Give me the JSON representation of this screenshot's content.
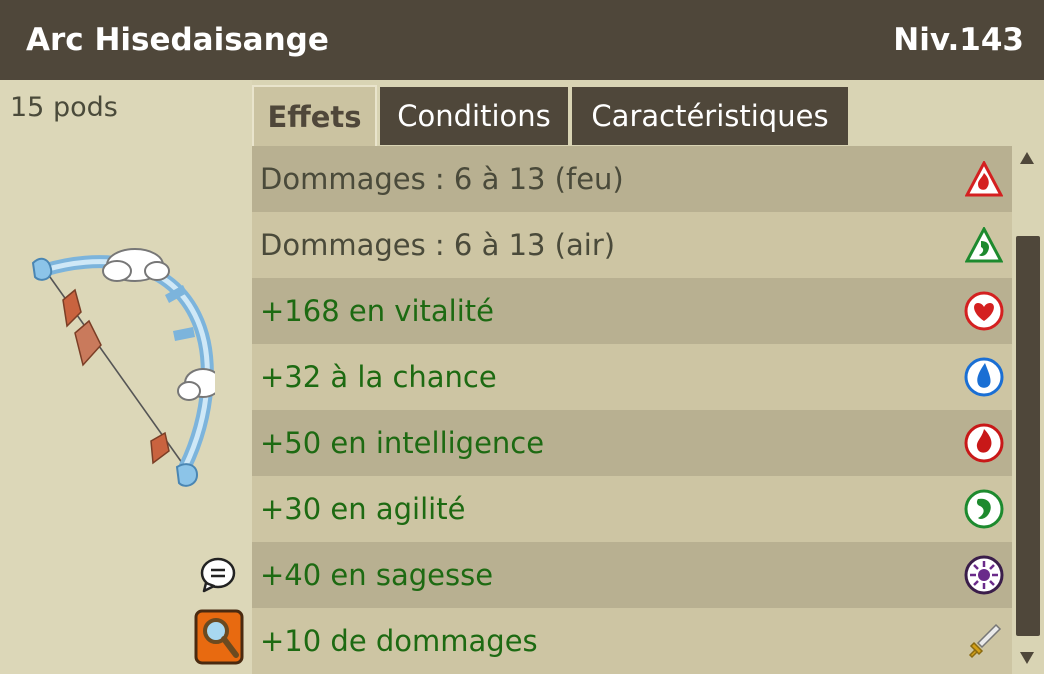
{
  "item": {
    "name": "Arc Hisedaisange",
    "level": "Niv.143",
    "weight": "15 pods"
  },
  "tabs": [
    {
      "label": "Effets",
      "active": true
    },
    {
      "label": "Conditions",
      "active": false
    },
    {
      "label": "Caractéristiques",
      "active": false
    }
  ],
  "effects": [
    {
      "text": "Dommages : 6 à 13 (feu)",
      "color": "#4a4a3a",
      "icon": "fire-damage-icon"
    },
    {
      "text": "Dommages : 6 à 13 (air)",
      "color": "#4a4a3a",
      "icon": "air-damage-icon"
    },
    {
      "text": "+168 en vitalité",
      "color": "#1d6a12",
      "icon": "vitality-heart-icon"
    },
    {
      "text": "+32 à la chance",
      "color": "#1d6a12",
      "icon": "chance-water-icon"
    },
    {
      "text": "+50 en intelligence",
      "color": "#1d6a12",
      "icon": "intelligence-fire-icon"
    },
    {
      "text": "+30 en agilité",
      "color": "#1d6a12",
      "icon": "agility-air-icon"
    },
    {
      "text": "+40 en sagesse",
      "color": "#1d6a12",
      "icon": "wisdom-icon"
    },
    {
      "text": "+10 de dommages",
      "color": "#1d6a12",
      "icon": "damage-sword-icon"
    }
  ],
  "colors": {
    "header_bg": "#4f473a",
    "row_dark": "#b8b091",
    "row_light": "#cdc5a3",
    "bonus_text": "#1d6a12"
  }
}
